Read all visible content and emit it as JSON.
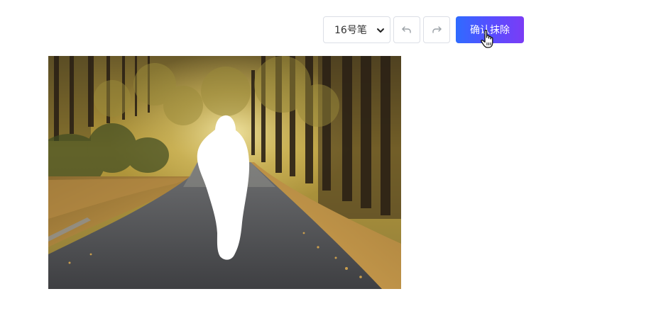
{
  "toolbar": {
    "brush_size": "16号笔",
    "confirm_label": "确认抹除"
  },
  "icons": {
    "undo": "undo-icon",
    "redo": "redo-icon",
    "dropdown": "chevron-down-icon",
    "cursor": "hand-pointer-icon"
  },
  "colors": {
    "button_gradient_start": "#2f6bff",
    "button_gradient_end": "#7b3cf5"
  }
}
